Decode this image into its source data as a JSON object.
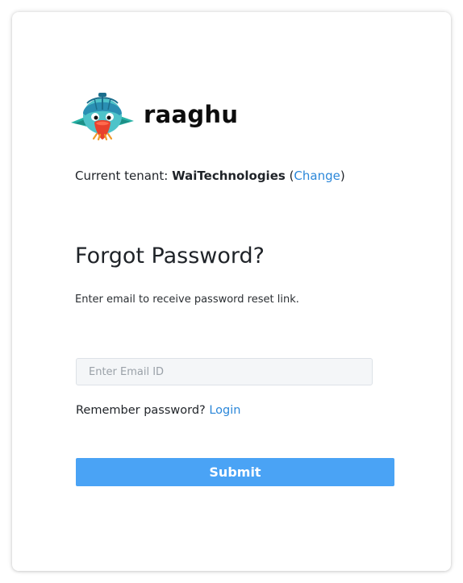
{
  "brand": {
    "name": "raaghu",
    "logo_icon": "parrot-mascot-icon"
  },
  "tenant": {
    "prefix": "Current tenant: ",
    "name": "WaiTechnologies",
    "open_paren": " (",
    "change_label": "Change",
    "close_paren": ")"
  },
  "form": {
    "title": "Forgot Password?",
    "subtitle": "Enter email to receive password reset link.",
    "email_placeholder": "Enter Email ID",
    "email_value": "",
    "remember_text": "Remember password? ",
    "login_label": "Login",
    "submit_label": "Submit"
  },
  "colors": {
    "link": "#2b87d9",
    "button": "#4aa3f5",
    "input_bg": "#f4f6f8"
  }
}
